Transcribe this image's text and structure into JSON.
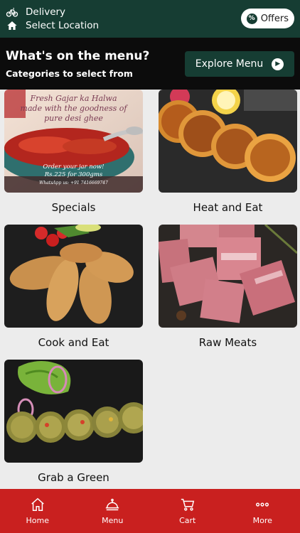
{
  "header": {
    "delivery_label": "Delivery",
    "location_label": "Select Location",
    "offers_label": "Offers",
    "offers_icon": "percent-badge-icon"
  },
  "menu_banner": {
    "title": "What's on the menu?",
    "subtitle": "Categories to select from",
    "explore_label": "Explore Menu"
  },
  "categories": [
    {
      "label": "Specials",
      "image_caption": [
        "Fresh Gajar ka Halwa",
        "made with the goodness of",
        "pure desi ghee",
        "Order your jar now!",
        "Rs.225 for 300gms",
        "WhatsApp us: +91 7416669747"
      ]
    },
    {
      "label": "Heat and Eat"
    },
    {
      "label": "Cook and Eat"
    },
    {
      "label": "Raw Meats"
    },
    {
      "label": "Grab a Green"
    }
  ],
  "bottom_nav": [
    {
      "label": "Home",
      "icon": "home-icon"
    },
    {
      "label": "Menu",
      "icon": "cloche-icon"
    },
    {
      "label": "Cart",
      "icon": "cart-icon"
    },
    {
      "label": "More",
      "icon": "more-icon"
    }
  ],
  "colors": {
    "header_green": "#163d33",
    "banner_black": "#0c0c0c",
    "nav_red": "#c9201f",
    "page_bg": "#ececec"
  }
}
